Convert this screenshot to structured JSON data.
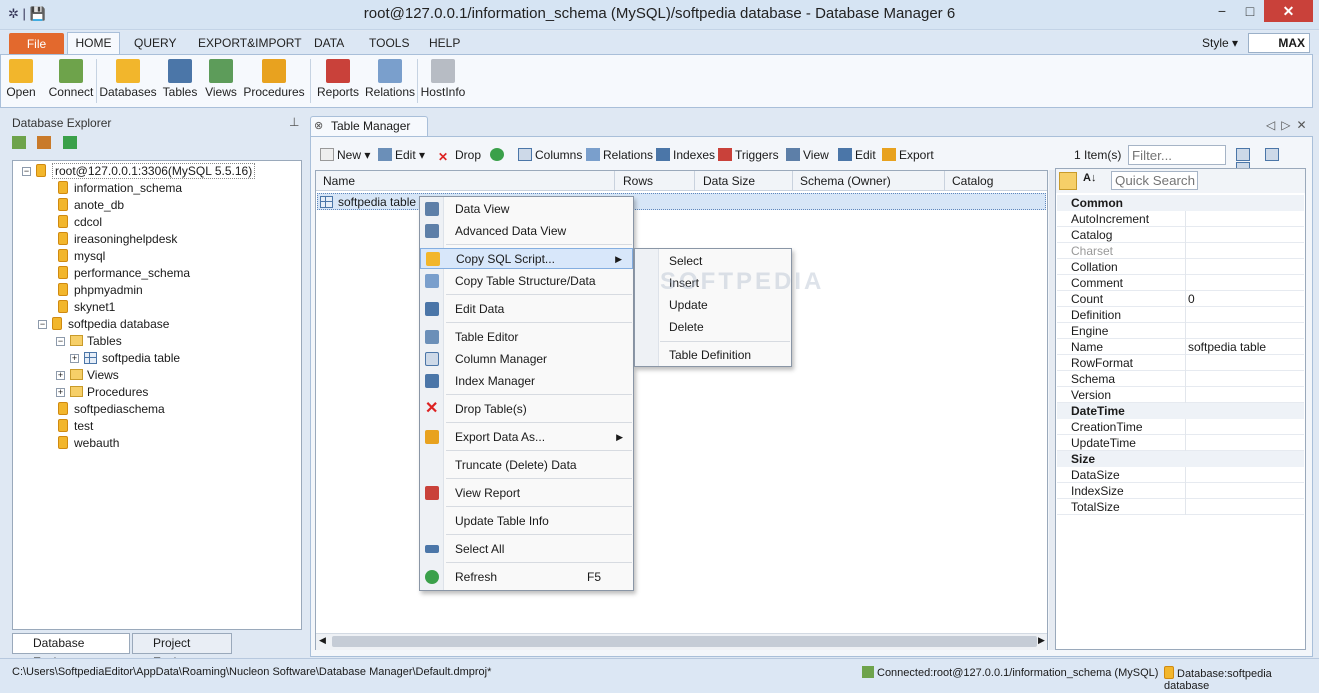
{
  "window": {
    "title": "root@127.0.0.1/information_schema (MySQL)/softpedia database - Database Manager 6",
    "min": "−",
    "max": "□",
    "close": "✕"
  },
  "ribbon": {
    "tabs": [
      "File",
      "HOME",
      "QUERY",
      "EXPORT&IMPORT",
      "DATA",
      "TOOLS",
      "HELP"
    ],
    "style_label": "Style",
    "style_value": "MAX",
    "buttons": [
      "Open",
      "Connect",
      "Databases",
      "Tables",
      "Views",
      "Procedures",
      "Reports",
      "Relations",
      "HostInfo"
    ]
  },
  "left_pane": {
    "title": "Database Explorer",
    "root": "root@127.0.0.1:3306(MySQL 5.5.16)",
    "databases": [
      "information_schema",
      "anote_db",
      "cdcol",
      "ireasoninghelpdesk",
      "mysql",
      "performance_schema",
      "phpmyadmin",
      "skynet1",
      "softpedia database"
    ],
    "children": [
      "Tables",
      "softpedia table",
      "Views",
      "Procedures"
    ],
    "more_databases": [
      "softpediaschema",
      "test",
      "webauth"
    ],
    "tabs": [
      "Database Explorer",
      "Project Explorer"
    ]
  },
  "document": {
    "tab": "Table Manager",
    "toolbar": [
      "New",
      "Edit",
      "Drop",
      "Columns",
      "Relations",
      "Indexes",
      "Triggers",
      "View",
      "Edit",
      "Export"
    ],
    "items_count": "1 Item(s)",
    "filter_placeholder": "Filter...",
    "columns": [
      "Name",
      "Rows",
      "Data Size",
      "Schema (Owner)",
      "Catalog"
    ],
    "row": "softpedia table"
  },
  "context_menu": {
    "items": [
      "Data View",
      "Advanced Data View",
      "Copy SQL Script...",
      "Copy Table Structure/Data",
      "Edit Data",
      "Table Editor",
      "Column Manager",
      "Index Manager",
      "Drop Table(s)",
      "Export Data As...",
      "Truncate (Delete) Data",
      "View Report",
      "Update Table Info",
      "Select All",
      "Refresh"
    ],
    "refresh_shortcut": "F5",
    "submenu": [
      "Select",
      "Insert",
      "Update",
      "Delete",
      "Table Definition"
    ]
  },
  "properties": {
    "quick_search_placeholder": "Quick Search",
    "categories": [
      "Common",
      "DateTime",
      "Size"
    ],
    "common": [
      "AutoIncrement",
      "Catalog",
      "Charset",
      "Collation",
      "Comment",
      "Count",
      "Definition",
      "Engine",
      "Name",
      "RowFormat",
      "Schema",
      "Version"
    ],
    "count_value": "0",
    "name_value": "softpedia table",
    "datetime": [
      "CreationTime",
      "UpdateTime"
    ],
    "size": [
      "DataSize",
      "IndexSize",
      "TotalSize"
    ]
  },
  "status": {
    "path": "C:\\Users\\SoftpediaEditor\\AppData\\Roaming\\Nucleon Software\\Database Manager\\Default.dmproj*",
    "connected": "Connected:root@127.0.0.1/information_schema (MySQL)",
    "database": "Database:softpedia database"
  },
  "watermark": "SOFTPEDIA",
  "colors": {
    "file_tab": "#e3692d",
    "selection": "#d8e7fa",
    "close": "#c9413a"
  }
}
